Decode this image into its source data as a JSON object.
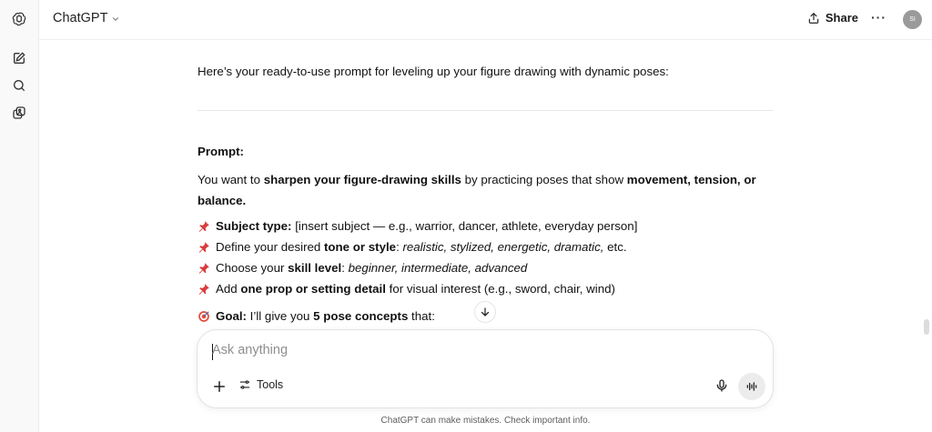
{
  "app": {
    "model_name": "ChatGPT"
  },
  "header": {
    "share_label": "Share",
    "more_label": "···",
    "avatar_initials": "SI"
  },
  "sidebar": {
    "icons": [
      "openai-logo-icon",
      "new-chat-icon",
      "search-icon",
      "library-icon"
    ]
  },
  "message": {
    "intro": "Here’s your ready-to-use prompt for leveling up your figure drawing with dynamic poses:",
    "prompt_label": "Prompt:",
    "para_1": "You want to ",
    "para_bold_1": "sharpen your figure-drawing skills",
    "para_2": " by practicing poses that show ",
    "para_bold_2": "movement, tension, or balance.",
    "bullets": [
      {
        "bold": "Subject type:",
        "text": " [insert subject — e.g., warrior, dancer, athlete, everyday person]"
      },
      {
        "pre": "Define your desired ",
        "bold": "tone or style",
        "colon": ": ",
        "italic": "realistic, stylized, energetic, dramatic,",
        "post": " etc."
      },
      {
        "pre": "Choose your ",
        "bold": "skill level",
        "colon": ": ",
        "italic": "beginner, intermediate, advanced"
      },
      {
        "pre": "Add ",
        "bold": "one prop or setting detail",
        "post": " for visual interest (e.g., sword, chair, wind)"
      }
    ],
    "goal_bold": "Goal:",
    "goal_text": " I’ll give you ",
    "goal_bold_2": "5 pose concepts",
    "goal_post": " that:"
  },
  "composer": {
    "placeholder": "Ask anything",
    "tools_label": "Tools"
  },
  "footer": {
    "disclaimer": "ChatGPT can make mistakes. Check important info."
  },
  "colors": {
    "pin": "#d93c3c",
    "goal": "#c0392b",
    "text": "#0d0d0d"
  }
}
